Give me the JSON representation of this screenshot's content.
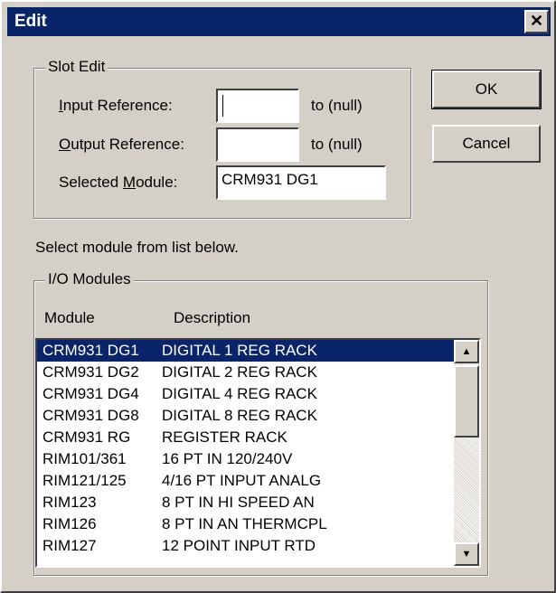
{
  "window": {
    "title": "Edit",
    "close_glyph": "✕"
  },
  "slot_edit": {
    "legend": "Slot Edit",
    "input_reference": {
      "label_u": "I",
      "label_rest": "nput Reference:",
      "value": "",
      "to_text": "to  (null)"
    },
    "output_reference": {
      "label_u": "O",
      "label_rest": "utput Reference:",
      "value": "",
      "to_text": "to  (null)"
    },
    "selected_module": {
      "label_pre": "Selected ",
      "label_u": "M",
      "label_rest": "odule:",
      "value": "CRM931 DG1"
    }
  },
  "buttons": {
    "ok": "OK",
    "cancel": "Cancel"
  },
  "instruction": "Select module from list below.",
  "io_modules": {
    "legend": "I/O Modules",
    "column_module": "Module",
    "column_description": "Description",
    "items": [
      {
        "module": "CRM931 DG1",
        "description": "DIGITAL 1 REG RACK",
        "selected": true
      },
      {
        "module": "CRM931 DG2",
        "description": "DIGITAL 2 REG RACK"
      },
      {
        "module": "CRM931 DG4",
        "description": "DIGITAL 4 REG RACK"
      },
      {
        "module": "CRM931 DG8",
        "description": "DIGITAL 8 REG RACK"
      },
      {
        "module": "CRM931 RG",
        "description": "REGISTER RACK"
      },
      {
        "module": "RIM101/361",
        "description": "16 PT IN 120/240V"
      },
      {
        "module": "RIM121/125",
        "description": "4/16 PT INPUT ANALG"
      },
      {
        "module": "RIM123",
        "description": "8 PT IN HI SPEED AN"
      },
      {
        "module": "RIM126",
        "description": "8 PT IN AN THERMCPL"
      },
      {
        "module": "RIM127",
        "description": "12 POINT INPUT RTD"
      }
    ]
  },
  "scrollbar": {
    "up_glyph": "▲",
    "down_glyph": "▼"
  },
  "colors": {
    "titlebar": "#0a246a",
    "face": "#d4d0c8",
    "selection": "#0a246a"
  }
}
